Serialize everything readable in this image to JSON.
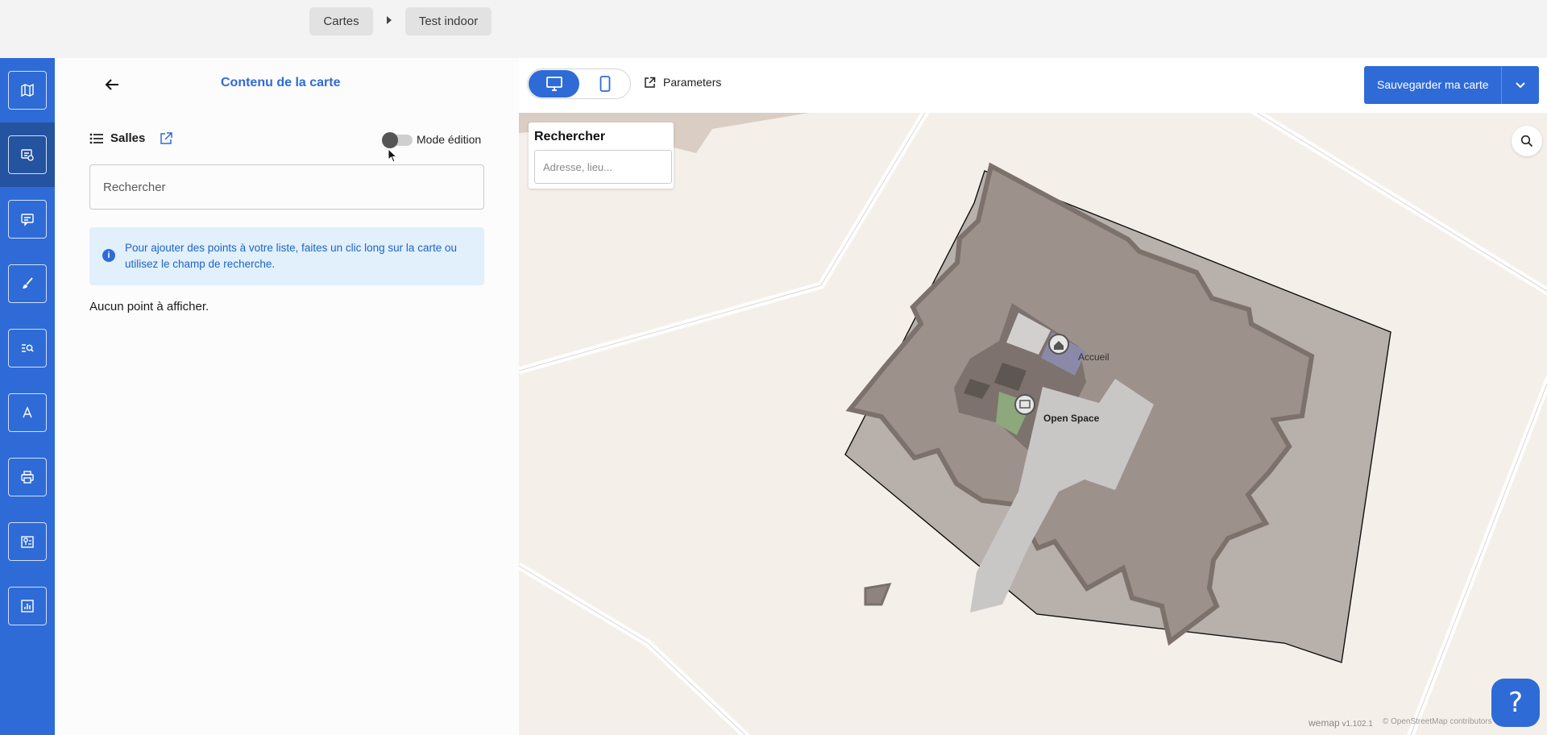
{
  "breadcrumb": {
    "items": [
      "Cartes",
      "Test indoor"
    ]
  },
  "rail": {
    "items": [
      {
        "icon": "map-icon"
      },
      {
        "icon": "map-content-icon"
      },
      {
        "icon": "message-icon"
      },
      {
        "icon": "brush-icon"
      },
      {
        "icon": "search-list-icon"
      },
      {
        "icon": "font-icon"
      },
      {
        "icon": "print-icon"
      },
      {
        "icon": "map-pin-icon"
      },
      {
        "icon": "stats-icon"
      }
    ]
  },
  "panel": {
    "title": "Contenu de la carte",
    "list_label": "Salles",
    "toggle_label": "Mode édition",
    "search_placeholder": "Rechercher",
    "info_text": "Pour ajouter des points à votre liste, faites un clic long sur la carte ou utilisez le champ de recherche.",
    "empty_text": "Aucun point à afficher."
  },
  "maphead": {
    "params_label": "Parameters",
    "save_label": "Sauvegarder ma carte"
  },
  "map": {
    "search_title": "Rechercher",
    "search_placeholder": "Adresse, lieu...",
    "labels": {
      "accueil": "Accueil",
      "open_space": "Open Space"
    },
    "attribution": {
      "brand": "wemap",
      "version": "v1.102.1",
      "osm": "© OpenStreetMap contributors"
    }
  },
  "colors": {
    "accent": "#2f6bd6",
    "accent_dark": "#24539f",
    "map_bg": "#f5efea",
    "building": "#9c8f88"
  }
}
